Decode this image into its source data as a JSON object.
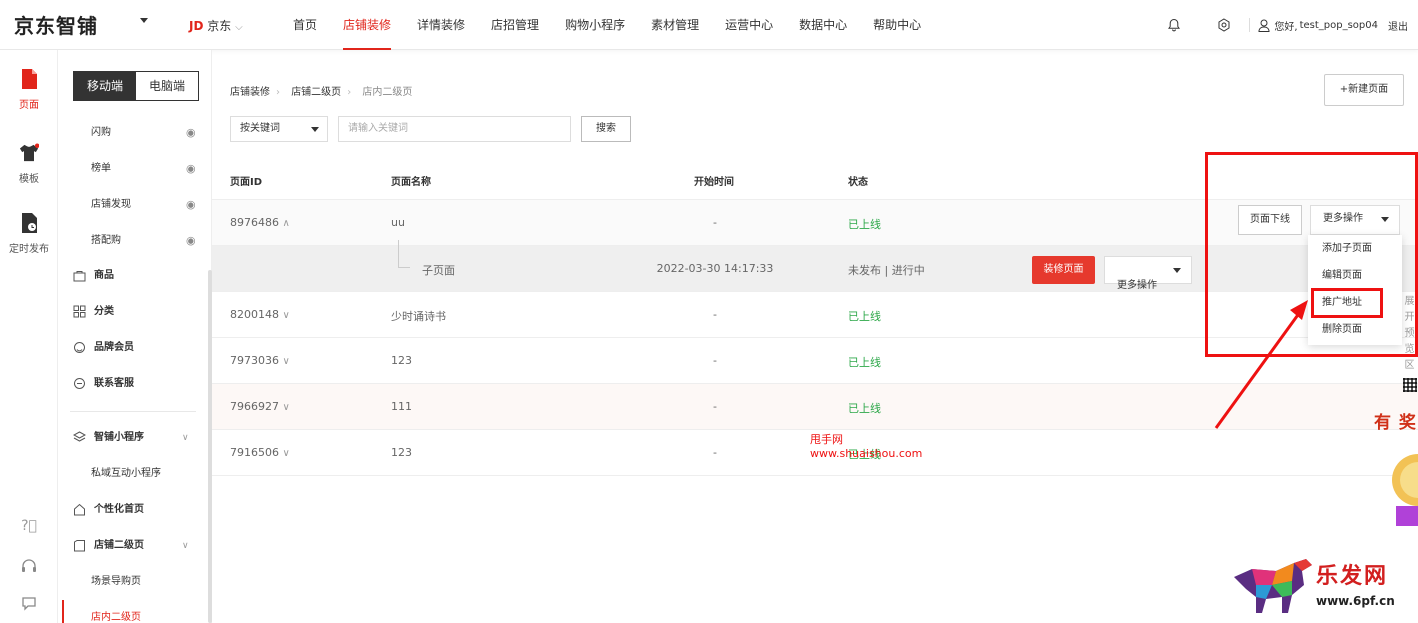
{
  "header": {
    "logo": "京东智铺",
    "jd_brand": "JD",
    "jd_label": "京东",
    "nav": [
      "首页",
      "店铺装修",
      "详情装修",
      "店招管理",
      "购物小程序",
      "素材管理",
      "运营中心",
      "数据中心",
      "帮助中心"
    ],
    "active_nav": "店铺装修",
    "greeting": "您好,",
    "username": "test_pop_sop04",
    "logout": "退出"
  },
  "rail": {
    "items": [
      "页面",
      "模板",
      "定时发布"
    ]
  },
  "sidebar": {
    "toggle": {
      "mobile": "移动端",
      "pc": "电脑端"
    },
    "items": [
      {
        "label": "闪购",
        "eye": true
      },
      {
        "label": "榜单",
        "eye": true
      },
      {
        "label": "店铺发现",
        "eye": true
      },
      {
        "label": "搭配购",
        "eye": true
      },
      {
        "label": "商品",
        "group": true
      },
      {
        "label": "分类",
        "group": true
      },
      {
        "label": "品牌会员",
        "group": true
      },
      {
        "label": "联系客服",
        "group": true
      },
      {
        "label": "智铺小程序",
        "group": true
      },
      {
        "label": "私域互动小程序"
      },
      {
        "label": "个性化首页",
        "group": true
      },
      {
        "label": "店铺二级页",
        "group": true
      },
      {
        "label": "场景导购页"
      },
      {
        "label": "店内二级页",
        "selected": true
      }
    ]
  },
  "breadcrumb": [
    "店铺装修",
    "店铺二级页",
    "店内二级页"
  ],
  "new_page_button": "+新建页面",
  "filter": {
    "select_value": "按关键词",
    "keyword_placeholder": "请输入关键词",
    "search_button": "搜索"
  },
  "table": {
    "columns": [
      "页面ID",
      "页面名称",
      "开始时间",
      "状态"
    ],
    "rows": [
      {
        "id": "8976486",
        "name": "uu",
        "time": "-",
        "status": "已上线",
        "expanded": true
      },
      {
        "id": "",
        "name": "子页面",
        "time": "2022-03-30 14:17:33",
        "status": "未发布 | 进行中",
        "child": true
      },
      {
        "id": "8200148",
        "name": "少时诵诗书",
        "time": "-",
        "status": "已上线"
      },
      {
        "id": "7973036",
        "name": "123",
        "time": "-",
        "status": "已上线"
      },
      {
        "id": "7966927",
        "name": "111",
        "time": "-",
        "status": "已上线"
      },
      {
        "id": "7916506",
        "name": "123",
        "time": "-",
        "status": "已上线"
      }
    ]
  },
  "actions": {
    "offline": "页面下线",
    "more": "更多操作",
    "decorate": "装修页面",
    "dropdown": [
      "添加子页面",
      "编辑页面",
      "推广地址",
      "删除页面"
    ],
    "highlighted_item": "推广地址"
  },
  "watermark": {
    "name": "甩手网",
    "url": "www.shuaishou.com"
  },
  "side_float": [
    "展",
    "开",
    "预",
    "览",
    "区"
  ],
  "reward_text": "有 奖",
  "brand_footer": {
    "name": "乐发网",
    "url": "www.6pf.cn"
  },
  "colors": {
    "accent": "#e1251b",
    "online": "#2ea84a",
    "annotation": "#ee1111"
  }
}
